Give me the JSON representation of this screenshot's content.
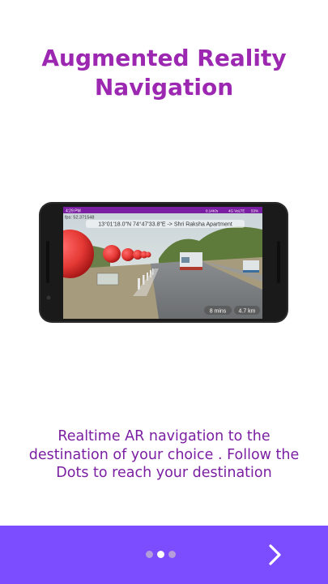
{
  "title": {
    "line1": "Augmented Reality",
    "line2": "Navigation"
  },
  "phone": {
    "status_time": "4:29 PM",
    "status_right": "0.14K/s",
    "network": "4G VoLTE",
    "battery": "53%",
    "fps": "fps: 52.371548",
    "coords_banner": "13°01'18.0\"N 74°47'33.8\"E -> Shri Raksha Apartment",
    "duration": "8 mins",
    "distance": "4.7 km"
  },
  "description": "Realtime AR navigation to the destination of your choice . Follow the Dots to reach your destination",
  "pager": {
    "count": 3,
    "active_index": 1
  },
  "next_icon": "chevron-right-icon",
  "colors": {
    "title": "#9c27b0",
    "description": "#7b1fa2",
    "footer": "#7c4dff",
    "dot_active": "#ffffff",
    "dot_inactive": "#b39ddb",
    "ar_dot": "#e53935"
  }
}
